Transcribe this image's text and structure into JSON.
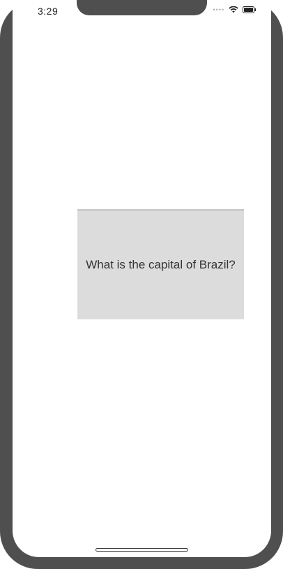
{
  "status_bar": {
    "time": "3:29",
    "signal_dots": "••••",
    "wifi_icon": "wifi-icon",
    "battery_icon": "battery-icon"
  },
  "card": {
    "question": "What is the capital of Brazil?"
  },
  "colors": {
    "frame": "#4f4f4f",
    "screen": "#ffffff",
    "card_background": "#dcdcdc"
  }
}
